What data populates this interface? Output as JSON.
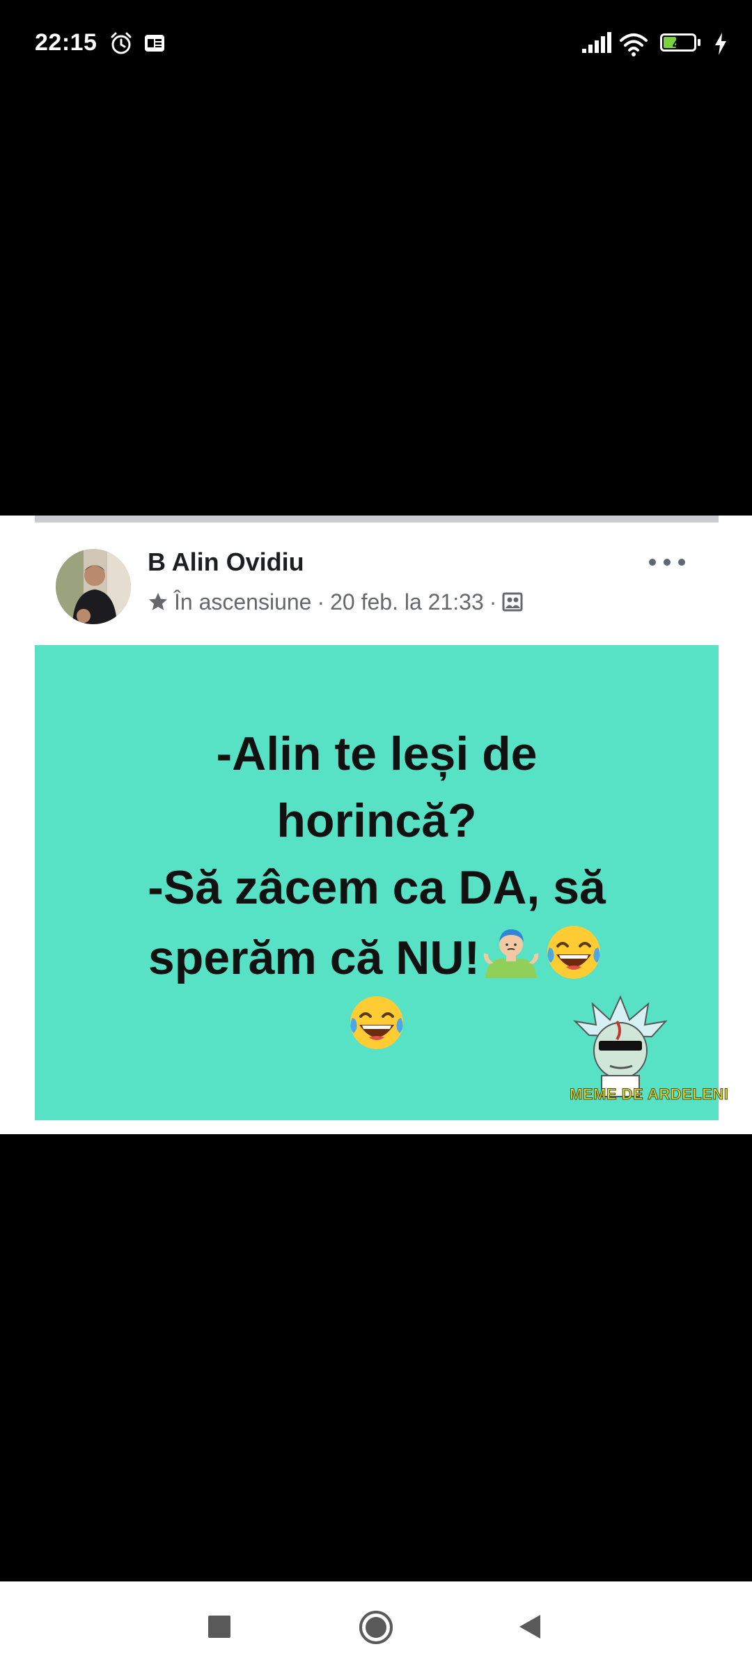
{
  "status_bar": {
    "time": "22:15",
    "battery_level": "43",
    "battery_fraction": 0.43,
    "icons": [
      "alarm-icon",
      "gallery-notification-icon",
      "signal-icon",
      "wifi-icon",
      "battery-icon",
      "charging-icon"
    ]
  },
  "post": {
    "author": "B Alin Ovidiu",
    "badge": "În ascensiune",
    "separator": "·",
    "timestamp": "20 feb. la 21:33",
    "more_icon": "more-options-icon",
    "audience_icon": "audience-icon",
    "image": {
      "background_color": "#57e2c6",
      "lines": [
        "-Alin te leși de",
        "horincă?",
        "-Să zâcem ca DA, să",
        "sperăm că NU!"
      ],
      "watermark": "MEME DE ARDELENI"
    }
  },
  "nav_bar": {
    "icons": [
      "recents-icon",
      "home-icon",
      "back-icon"
    ]
  },
  "colors": {
    "accent_text": "#1c1e21",
    "meta_text": "#65676b",
    "battery_fill": "#7bd23f"
  }
}
